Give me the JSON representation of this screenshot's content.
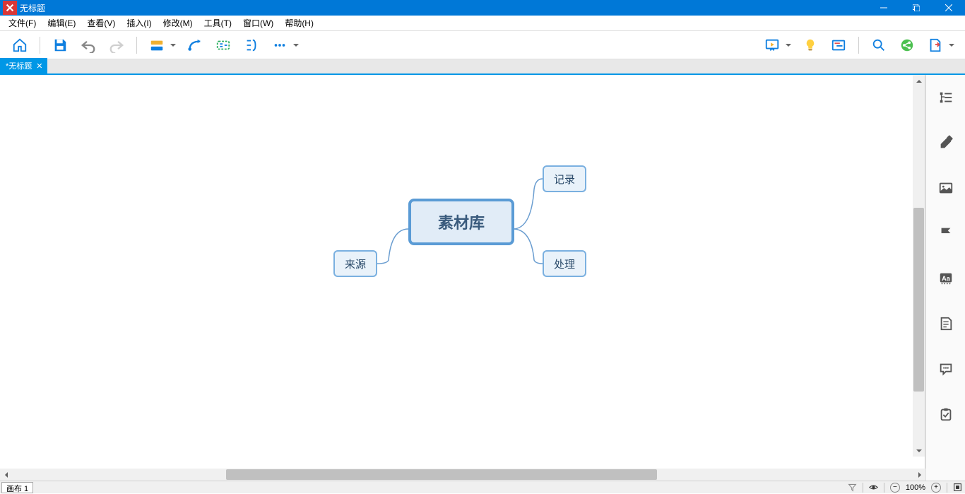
{
  "window": {
    "title": "无标题"
  },
  "menu": {
    "file": "文件(F)",
    "edit": "编辑(E)",
    "view": "查看(V)",
    "insert": "插入(I)",
    "modify": "修改(M)",
    "tools": "工具(T)",
    "window": "窗口(W)",
    "help": "帮助(H)"
  },
  "tab": {
    "label": "*无标题"
  },
  "mindmap": {
    "central": "素材库",
    "children": {
      "top_right": "记录",
      "bottom_right": "处理",
      "left": "来源"
    }
  },
  "sheet": {
    "label": "画布 1"
  },
  "status": {
    "zoom": "100%"
  },
  "colors": {
    "accent": "#0078d7",
    "node_border": "#5a9bd5",
    "node_fill": "#e1ecf7"
  },
  "toolbar_icons": [
    "home-icon",
    "save-icon",
    "undo-icon",
    "redo-icon",
    "topic-icon",
    "relation-icon",
    "boundary-icon",
    "summary-icon",
    "more-icon",
    "presentation-icon",
    "idea-icon",
    "gantt-icon",
    "search-icon",
    "share-icon",
    "export-icon"
  ],
  "sidebar_icons": [
    "outline-icon",
    "format-icon",
    "image-icon",
    "marker-icon",
    "font-icon",
    "notes-icon",
    "comments-icon",
    "task-icon"
  ]
}
